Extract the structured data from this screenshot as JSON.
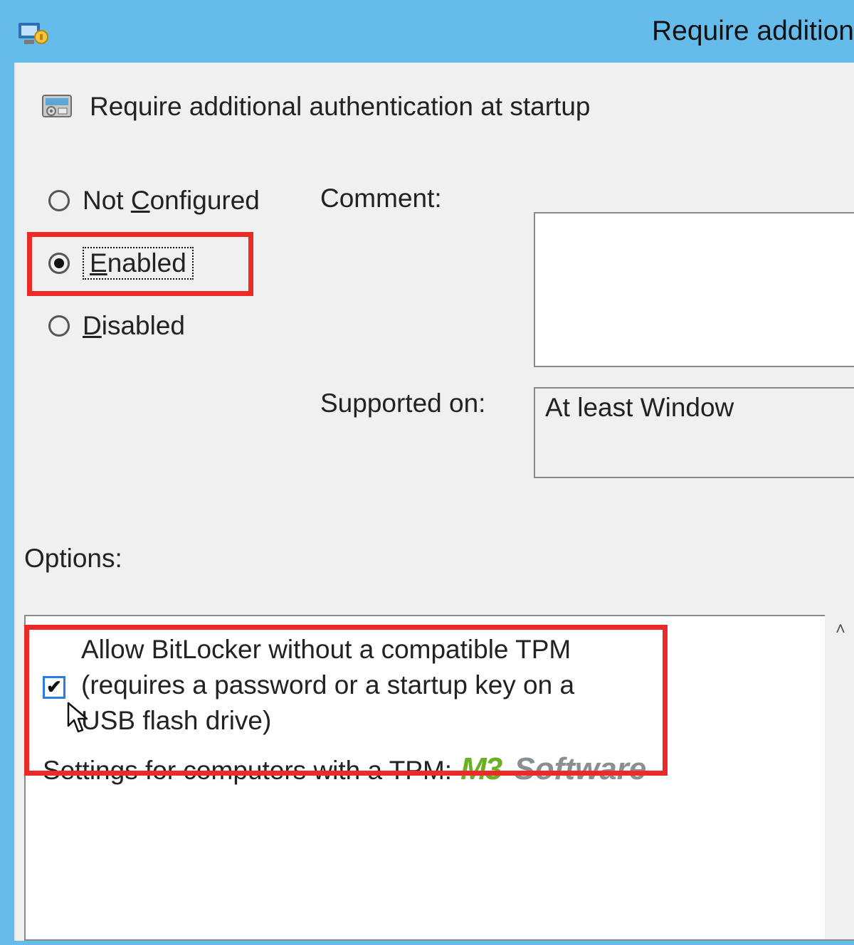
{
  "window": {
    "title": "Require addition"
  },
  "policy": {
    "title": "Require additional authentication at startup"
  },
  "radios": {
    "not_configured": "Not Configured",
    "enabled": "Enabled",
    "disabled": "Disabled",
    "selected": "enabled"
  },
  "fields": {
    "comment_label": "Comment:",
    "supported_label": "Supported on:",
    "supported_value": "At least Window"
  },
  "options": {
    "label": "Options:",
    "allow_line1": "Allow BitLocker without a compatible TPM",
    "allow_line2": "(requires a password or a startup key on a",
    "allow_line3": "USB flash drive)",
    "tpm_settings_label": "Settings for computers with a TPM:",
    "allow_checked": true
  },
  "watermark": {
    "brand1": "M3",
    "brand2": "Software"
  }
}
